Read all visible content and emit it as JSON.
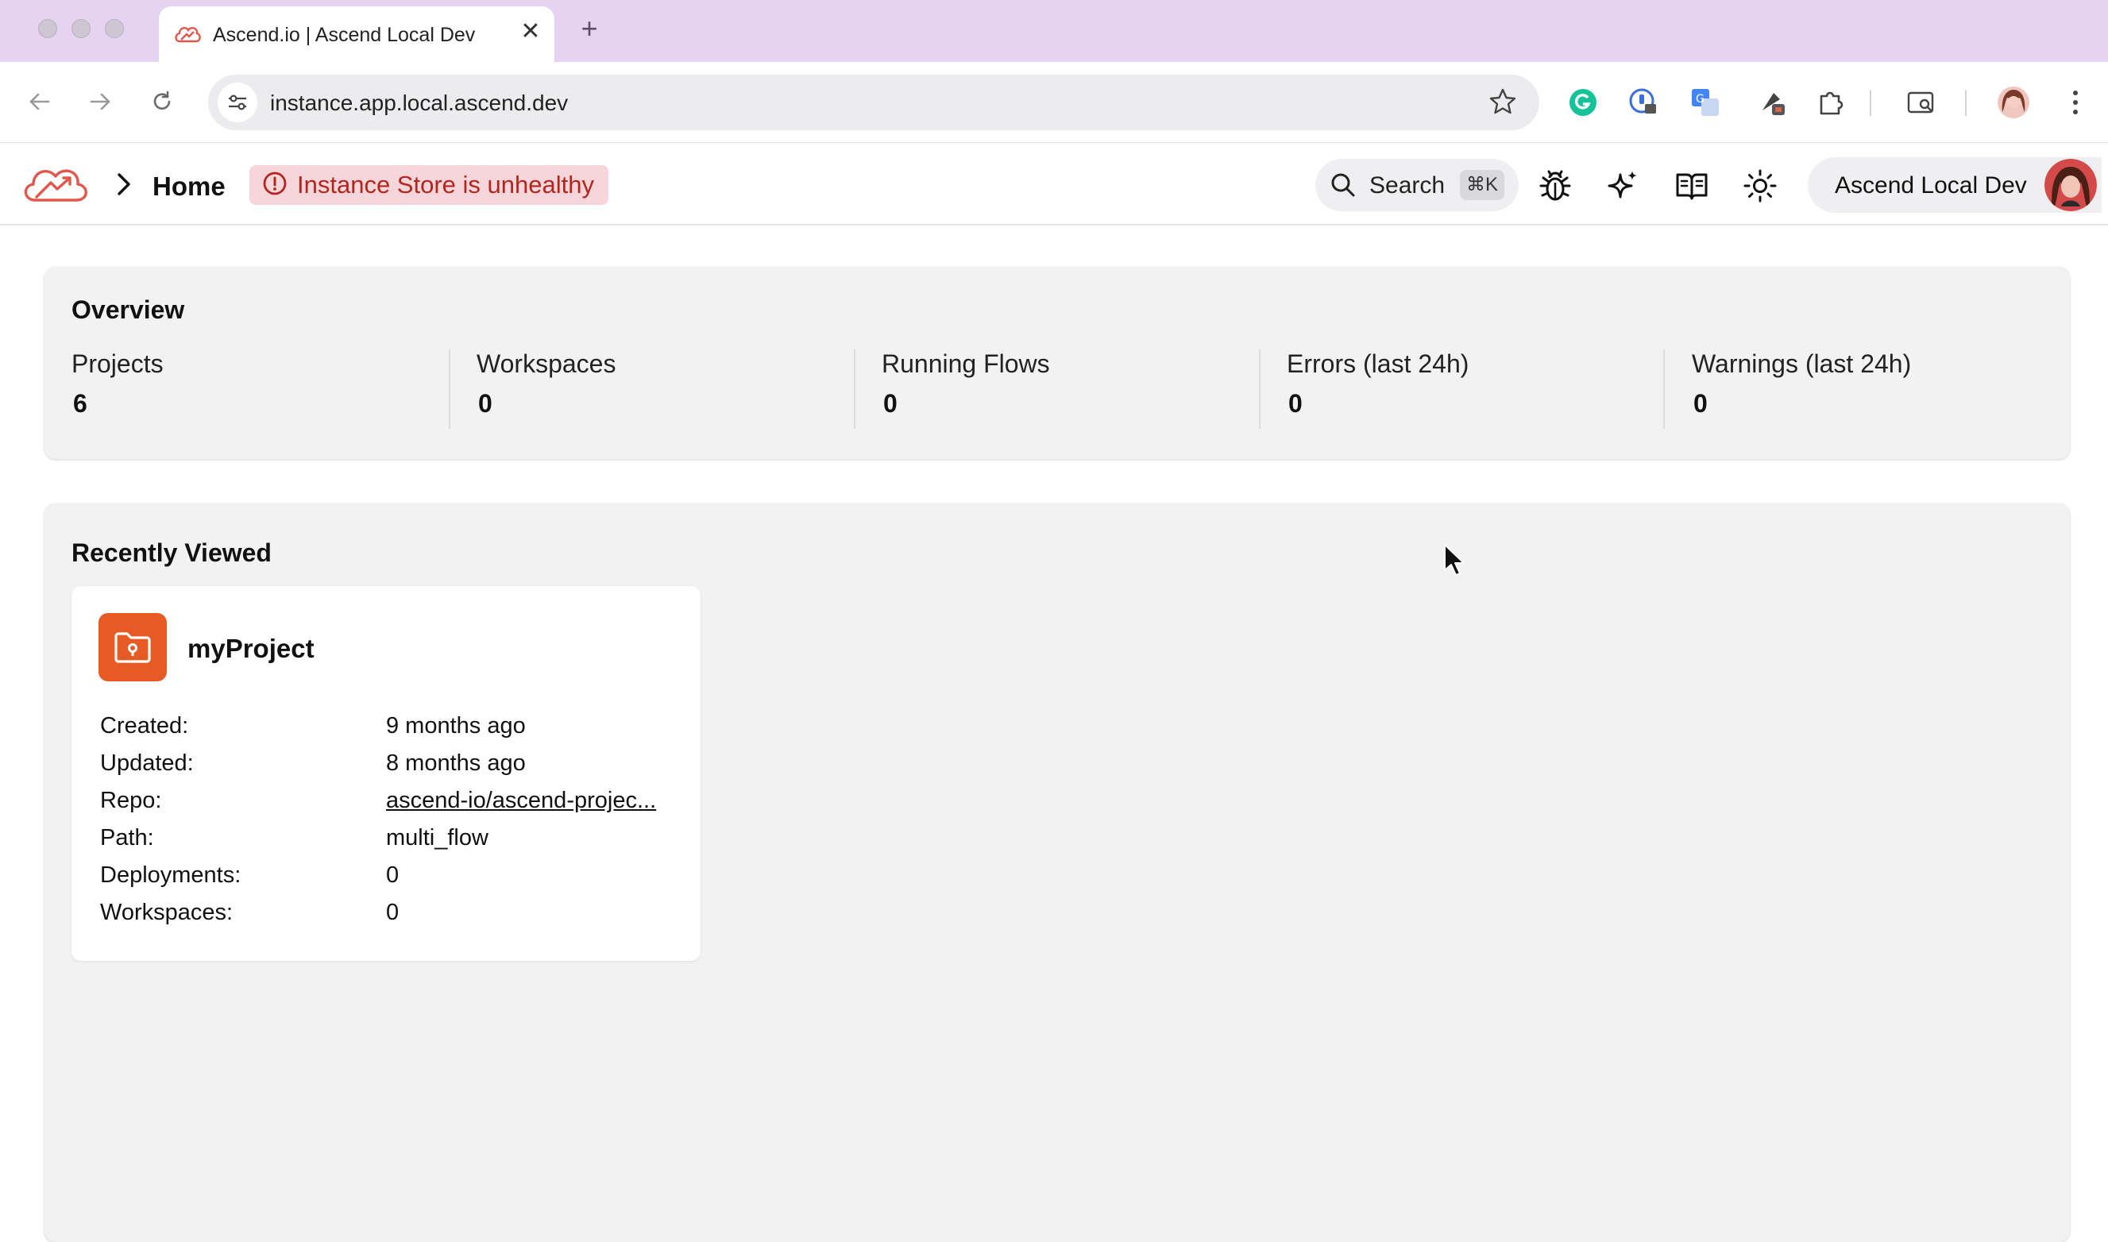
{
  "browser": {
    "tab_title": "Ascend.io | Ascend Local Dev",
    "tab_close": "✕",
    "new_tab": "+",
    "url": "instance.app.local.ascend.dev"
  },
  "header": {
    "breadcrumb_home": "Home",
    "health_badge": "Instance Store is unhealthy",
    "search_label": "Search",
    "search_shortcut": "⌘K",
    "user_label": "Ascend Local Dev"
  },
  "overview": {
    "title": "Overview",
    "stats": [
      {
        "label": "Projects",
        "value": "6"
      },
      {
        "label": "Workspaces",
        "value": "0"
      },
      {
        "label": "Running Flows",
        "value": "0"
      },
      {
        "label": "Errors (last 24h)",
        "value": "0"
      },
      {
        "label": "Warnings (last 24h)",
        "value": "0"
      }
    ]
  },
  "recent": {
    "title": "Recently Viewed",
    "project": {
      "name": "myProject",
      "fields": [
        {
          "key": "Created:",
          "value": "9 months ago"
        },
        {
          "key": "Updated:",
          "value": "8 months ago"
        },
        {
          "key": "Repo:",
          "value": "ascend-io/ascend-projec..."
        },
        {
          "key": "Path:",
          "value": "multi_flow"
        },
        {
          "key": "Deployments:",
          "value": "0"
        },
        {
          "key": "Workspaces:",
          "value": "0"
        }
      ]
    }
  },
  "colors": {
    "tabbar": "#e6d3f2",
    "brand_red": "#e2574c",
    "project_orange": "#e65a24",
    "danger_text": "#b3261e",
    "danger_bg": "#f6d6da"
  },
  "icons": [
    "cloud-logo-icon",
    "chevron-right-icon",
    "alert-circle-icon",
    "search-icon",
    "bug-icon",
    "sparkle-icon",
    "book-icon",
    "sun-icon",
    "folder-icon",
    "cursor-icon"
  ]
}
